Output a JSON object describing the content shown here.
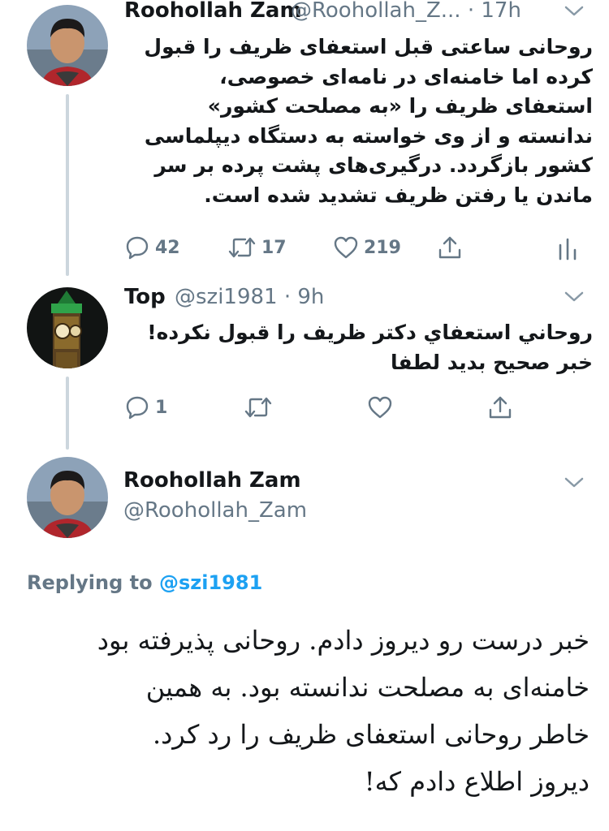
{
  "tweets": [
    {
      "author_name": "Roohollah Zam",
      "handle_time": "@Roohollah_Z... · 17h",
      "text_lines": [
        "روحانی ساعتی قبل استعفای ظریف را قبول",
        "کرده اما خامنه‌ای در نامه‌ای خصوصی،",
        "استعفای ظریف را «به مصلحت کشور»",
        "ندانسته و از وی خواسته به دستگاه دیپلماسی",
        "کشور بازگردد. درگیری‌های پشت پرده بر سر",
        "ماندن یا رفتن ظریف تشدید شده است."
      ],
      "reply_count": "42",
      "retweet_count": "17",
      "like_count": "219"
    },
    {
      "author_name": "Top",
      "handle_time": "@szi1981 · 9h",
      "text_lines": [
        "روحاني استعفاي دكتر ظريف را قبول نكرده!",
        "خبر صحيح بديد لطفا"
      ],
      "reply_count": "1"
    }
  ],
  "main_tweet": {
    "author_name": "Roohollah Zam",
    "handle": "@Roohollah_Zam",
    "replying_label": "Replying to",
    "replying_handle": "@szi1981",
    "text_lines": [
      "خبر درست رو دیروز دادم. روحانی پذیرفته بود",
      "خامنه‌ای به مصلحت ندانسته بود. به همین",
      "خاطر روحانی استعفای ظریف را رد کرد.",
      "دیروز اطلاع دادم که!"
    ]
  },
  "colors": {
    "secondary": "#657786",
    "link": "#1da1f2",
    "thread_line": "#ccd6dd"
  },
  "icons": [
    "reply-icon",
    "retweet-icon",
    "like-icon",
    "share-icon",
    "analytics-icon",
    "chevron-down-icon"
  ]
}
